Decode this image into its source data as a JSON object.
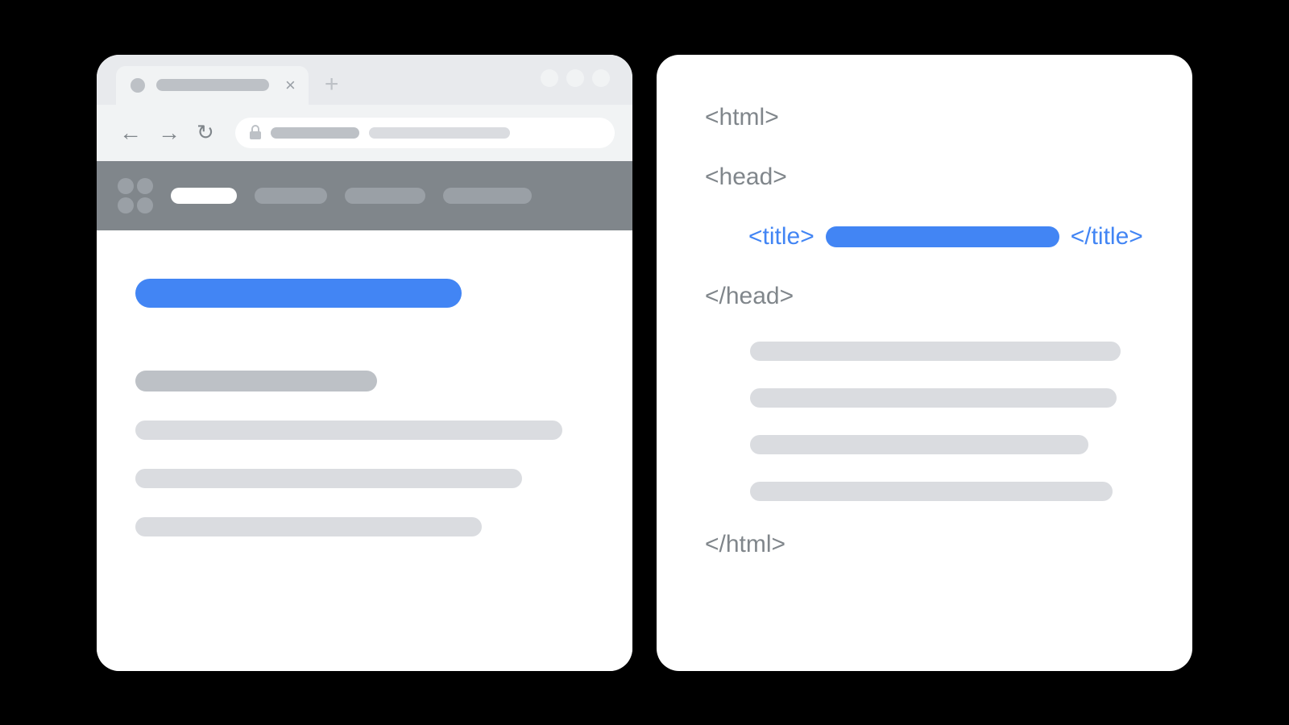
{
  "colors": {
    "accent_blue": "#4285f4",
    "grey_dark": "#80868b",
    "grey_mid": "#bdc1c6",
    "grey_light": "#dadce0",
    "chrome_bg": "#e8eaed",
    "toolbar_bg": "#f1f3f4"
  },
  "browser": {
    "tab": {
      "close_glyph": "×",
      "new_tab_glyph": "+"
    },
    "toolbar": {
      "back_glyph": "←",
      "forward_glyph": "→",
      "reload_glyph": "↻"
    }
  },
  "code": {
    "tag_html_open": "<html>",
    "tag_head_open": "<head>",
    "tag_title_open": "<title>",
    "tag_title_close": "</title>",
    "tag_head_close": "</head>",
    "tag_html_close": "</html>"
  }
}
